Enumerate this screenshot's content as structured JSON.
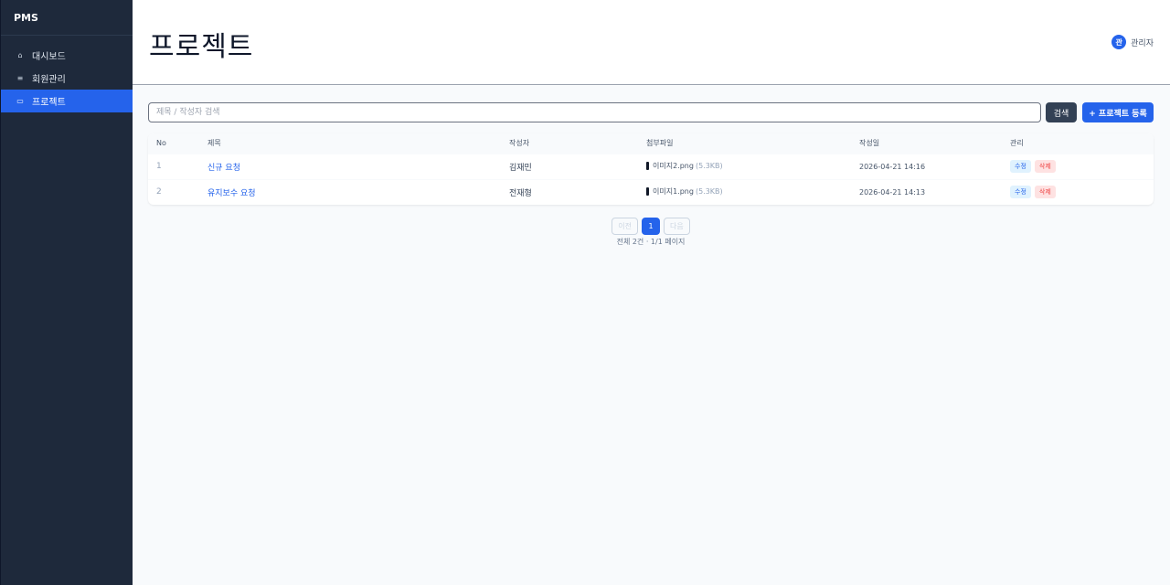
{
  "app": {
    "brand": "PMS"
  },
  "sidebar": {
    "items": [
      {
        "label": "대시보드",
        "icon": "home-icon",
        "glyph": "⌂",
        "active": false
      },
      {
        "label": "회원관리",
        "icon": "users-icon",
        "glyph": "≡",
        "active": false
      },
      {
        "label": "프로젝트",
        "icon": "folder-icon",
        "glyph": "▭",
        "active": true
      }
    ]
  },
  "header": {
    "title": "프로젝트",
    "user": {
      "avatar_initial": "관",
      "name": "관리자"
    }
  },
  "search": {
    "placeholder": "제목 / 작성자 검색",
    "value": "",
    "search_label": "검색",
    "add_label": "+ 프로젝트 등록"
  },
  "table": {
    "columns": [
      "No",
      "제목",
      "작성자",
      "첨부파일",
      "작성일",
      "관리"
    ],
    "rows": [
      {
        "no": "1",
        "title": "신규 요청",
        "author": "김재민",
        "file_name": "이미지2.png",
        "file_size": "(5.3KB)",
        "date": "2026-04-21 14:16",
        "edit": "수정",
        "delete": "삭제"
      },
      {
        "no": "2",
        "title": "유지보수 요청",
        "author": "전재형",
        "file_name": "이미지1.png",
        "file_size": "(5.3KB)",
        "date": "2026-04-21 14:13",
        "edit": "수정",
        "delete": "삭제"
      }
    ]
  },
  "pagination": {
    "prev_label": "이전",
    "current_page": "1",
    "next_label": "다음",
    "info": "전체 2건 · 1/1 페이지"
  },
  "colors": {
    "sidebar_bg": "#1e293b",
    "accent": "#2563eb",
    "danger": "#ef4444"
  }
}
